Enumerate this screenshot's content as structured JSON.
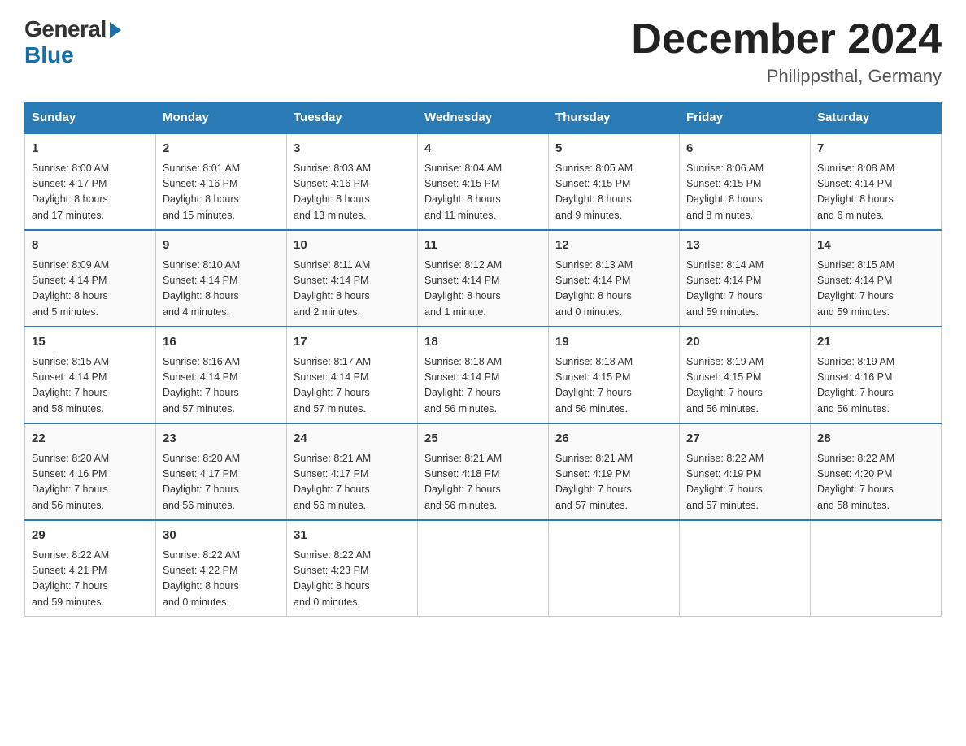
{
  "header": {
    "logo_general": "General",
    "logo_blue": "Blue",
    "month_title": "December 2024",
    "location": "Philippsthal, Germany"
  },
  "days_of_week": [
    "Sunday",
    "Monday",
    "Tuesday",
    "Wednesday",
    "Thursday",
    "Friday",
    "Saturday"
  ],
  "weeks": [
    {
      "days": [
        {
          "num": "1",
          "sunrise": "8:00 AM",
          "sunset": "4:17 PM",
          "daylight": "8 hours and 17 minutes."
        },
        {
          "num": "2",
          "sunrise": "8:01 AM",
          "sunset": "4:16 PM",
          "daylight": "8 hours and 15 minutes."
        },
        {
          "num": "3",
          "sunrise": "8:03 AM",
          "sunset": "4:16 PM",
          "daylight": "8 hours and 13 minutes."
        },
        {
          "num": "4",
          "sunrise": "8:04 AM",
          "sunset": "4:15 PM",
          "daylight": "8 hours and 11 minutes."
        },
        {
          "num": "5",
          "sunrise": "8:05 AM",
          "sunset": "4:15 PM",
          "daylight": "8 hours and 9 minutes."
        },
        {
          "num": "6",
          "sunrise": "8:06 AM",
          "sunset": "4:15 PM",
          "daylight": "8 hours and 8 minutes."
        },
        {
          "num": "7",
          "sunrise": "8:08 AM",
          "sunset": "4:14 PM",
          "daylight": "8 hours and 6 minutes."
        }
      ]
    },
    {
      "days": [
        {
          "num": "8",
          "sunrise": "8:09 AM",
          "sunset": "4:14 PM",
          "daylight": "8 hours and 5 minutes."
        },
        {
          "num": "9",
          "sunrise": "8:10 AM",
          "sunset": "4:14 PM",
          "daylight": "8 hours and 4 minutes."
        },
        {
          "num": "10",
          "sunrise": "8:11 AM",
          "sunset": "4:14 PM",
          "daylight": "8 hours and 2 minutes."
        },
        {
          "num": "11",
          "sunrise": "8:12 AM",
          "sunset": "4:14 PM",
          "daylight": "8 hours and 1 minute."
        },
        {
          "num": "12",
          "sunrise": "8:13 AM",
          "sunset": "4:14 PM",
          "daylight": "8 hours and 0 minutes."
        },
        {
          "num": "13",
          "sunrise": "8:14 AM",
          "sunset": "4:14 PM",
          "daylight": "7 hours and 59 minutes."
        },
        {
          "num": "14",
          "sunrise": "8:15 AM",
          "sunset": "4:14 PM",
          "daylight": "7 hours and 59 minutes."
        }
      ]
    },
    {
      "days": [
        {
          "num": "15",
          "sunrise": "8:15 AM",
          "sunset": "4:14 PM",
          "daylight": "7 hours and 58 minutes."
        },
        {
          "num": "16",
          "sunrise": "8:16 AM",
          "sunset": "4:14 PM",
          "daylight": "7 hours and 57 minutes."
        },
        {
          "num": "17",
          "sunrise": "8:17 AM",
          "sunset": "4:14 PM",
          "daylight": "7 hours and 57 minutes."
        },
        {
          "num": "18",
          "sunrise": "8:18 AM",
          "sunset": "4:14 PM",
          "daylight": "7 hours and 56 minutes."
        },
        {
          "num": "19",
          "sunrise": "8:18 AM",
          "sunset": "4:15 PM",
          "daylight": "7 hours and 56 minutes."
        },
        {
          "num": "20",
          "sunrise": "8:19 AM",
          "sunset": "4:15 PM",
          "daylight": "7 hours and 56 minutes."
        },
        {
          "num": "21",
          "sunrise": "8:19 AM",
          "sunset": "4:16 PM",
          "daylight": "7 hours and 56 minutes."
        }
      ]
    },
    {
      "days": [
        {
          "num": "22",
          "sunrise": "8:20 AM",
          "sunset": "4:16 PM",
          "daylight": "7 hours and 56 minutes."
        },
        {
          "num": "23",
          "sunrise": "8:20 AM",
          "sunset": "4:17 PM",
          "daylight": "7 hours and 56 minutes."
        },
        {
          "num": "24",
          "sunrise": "8:21 AM",
          "sunset": "4:17 PM",
          "daylight": "7 hours and 56 minutes."
        },
        {
          "num": "25",
          "sunrise": "8:21 AM",
          "sunset": "4:18 PM",
          "daylight": "7 hours and 56 minutes."
        },
        {
          "num": "26",
          "sunrise": "8:21 AM",
          "sunset": "4:19 PM",
          "daylight": "7 hours and 57 minutes."
        },
        {
          "num": "27",
          "sunrise": "8:22 AM",
          "sunset": "4:19 PM",
          "daylight": "7 hours and 57 minutes."
        },
        {
          "num": "28",
          "sunrise": "8:22 AM",
          "sunset": "4:20 PM",
          "daylight": "7 hours and 58 minutes."
        }
      ]
    },
    {
      "days": [
        {
          "num": "29",
          "sunrise": "8:22 AM",
          "sunset": "4:21 PM",
          "daylight": "7 hours and 59 minutes."
        },
        {
          "num": "30",
          "sunrise": "8:22 AM",
          "sunset": "4:22 PM",
          "daylight": "8 hours and 0 minutes."
        },
        {
          "num": "31",
          "sunrise": "8:22 AM",
          "sunset": "4:23 PM",
          "daylight": "8 hours and 0 minutes."
        },
        null,
        null,
        null,
        null
      ]
    }
  ],
  "labels": {
    "sunrise": "Sunrise:",
    "sunset": "Sunset:",
    "daylight": "Daylight:"
  }
}
